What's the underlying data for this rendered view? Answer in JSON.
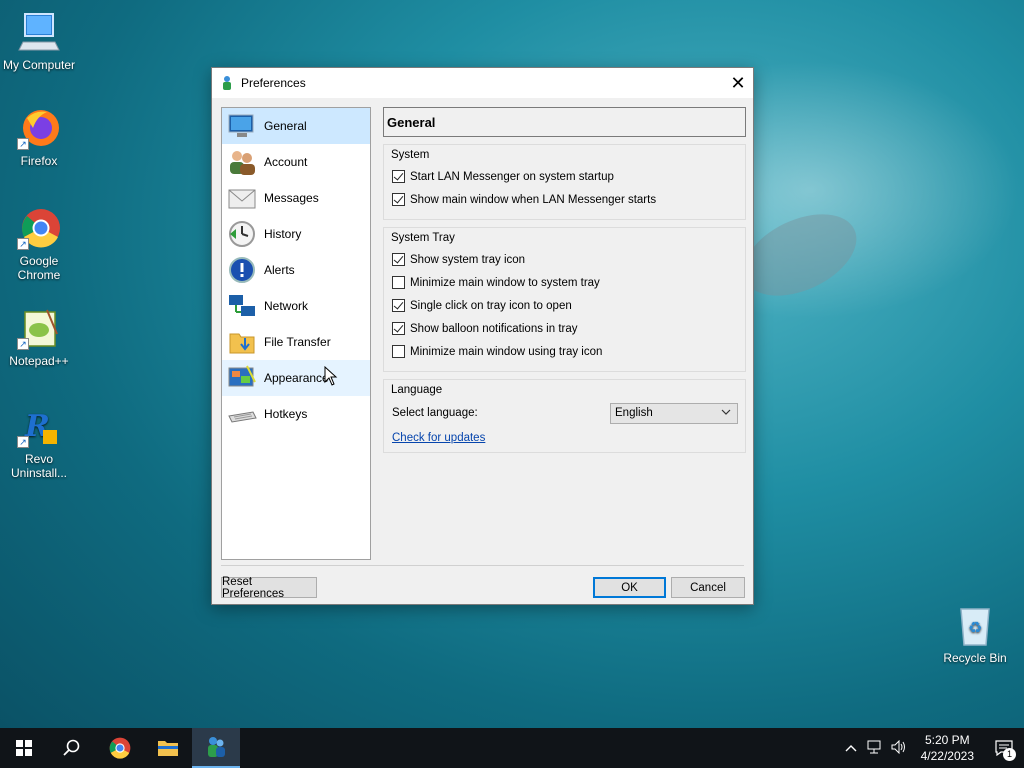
{
  "desktop": {
    "icons": [
      {
        "label": "My Computer",
        "icon": "computer-icon"
      },
      {
        "label": "Firefox",
        "icon": "firefox-icon"
      },
      {
        "label": "Google Chrome",
        "icon": "chrome-icon"
      },
      {
        "label": "Notepad++",
        "icon": "notepad-plus-plus-icon"
      },
      {
        "label": "Revo Uninstall...",
        "icon": "revo-uninstaller-icon"
      },
      {
        "label": "Recycle Bin",
        "icon": "recycle-bin-icon"
      }
    ]
  },
  "dialog": {
    "title": "Preferences",
    "close_glyph": "✕",
    "nav": [
      {
        "label": "General",
        "icon": "monitor-icon"
      },
      {
        "label": "Account",
        "icon": "users-icon"
      },
      {
        "label": "Messages",
        "icon": "envelope-icon"
      },
      {
        "label": "History",
        "icon": "clock-icon"
      },
      {
        "label": "Alerts",
        "icon": "info-alert-icon"
      },
      {
        "label": "Network",
        "icon": "network-icon"
      },
      {
        "label": "File Transfer",
        "icon": "folder-icon"
      },
      {
        "label": "Appearance",
        "icon": "appearance-icon"
      },
      {
        "label": "Hotkeys",
        "icon": "keyboard-icon"
      }
    ],
    "active_nav": "General",
    "header": "General",
    "system": {
      "title": "System",
      "options": [
        {
          "label": "Start LAN Messenger on system startup",
          "checked": true
        },
        {
          "label": "Show main window when LAN Messenger starts",
          "checked": true
        }
      ]
    },
    "tray": {
      "title": "System Tray",
      "options": [
        {
          "label": "Show system tray icon",
          "checked": true
        },
        {
          "label": "Minimize main window to system tray",
          "checked": false
        },
        {
          "label": "Single click on tray icon to open",
          "checked": true
        },
        {
          "label": "Show balloon notifications in tray",
          "checked": true
        },
        {
          "label": "Minimize main window using tray icon",
          "checked": false
        }
      ]
    },
    "language": {
      "title": "Language",
      "select_label": "Select language:",
      "selected": "English",
      "check_updates": "Check for updates"
    },
    "buttons": {
      "reset": "Reset Preferences",
      "ok": "OK",
      "cancel": "Cancel"
    }
  },
  "taskbar": {
    "time": "5:20 PM",
    "date": "4/22/2023",
    "notification_count": "1"
  },
  "colors": {
    "accent": "#0078d7",
    "nav_active": "#cde8ff",
    "link": "#0645ad"
  }
}
